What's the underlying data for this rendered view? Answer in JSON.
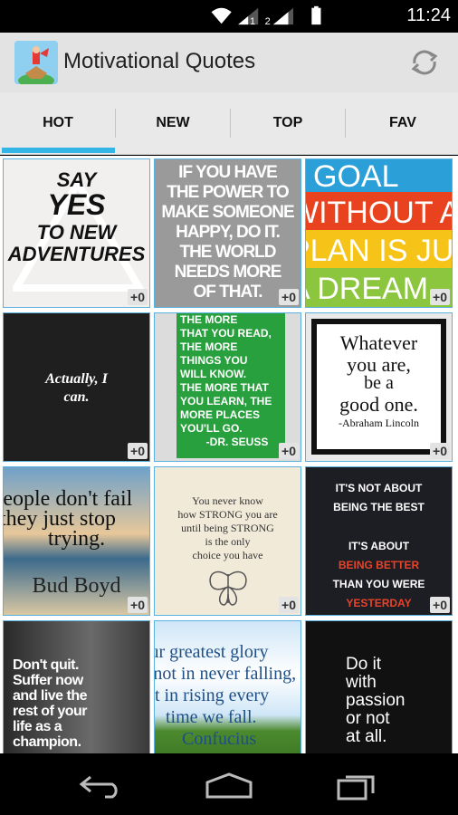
{
  "status_bar": {
    "time": "11:24",
    "sim1": "1",
    "sim2": "2"
  },
  "app": {
    "title": "Motivational Quotes"
  },
  "tabs": [
    {
      "label": "HOT",
      "active": true
    },
    {
      "label": "NEW",
      "active": false
    },
    {
      "label": "TOP",
      "active": false
    },
    {
      "label": "FAV",
      "active": false
    }
  ],
  "colors": {
    "accent": "#33b5e5",
    "action_bar": "#e3e3e3"
  },
  "tiles": [
    {
      "lines": [
        "SAY",
        "YES",
        "TO NEW",
        "ADVENTURES"
      ],
      "count": "+0"
    },
    {
      "lines": [
        "IF YOU HAVE",
        "THE POWER TO",
        "MAKE SOMEONE",
        "HAPPY, DO IT.",
        "THE WORLD",
        "NEEDS MORE",
        "OF THAT."
      ],
      "count": "+0"
    },
    {
      "lines": [
        "GOAL",
        "WITHOUT A",
        "PLAN IS JUST",
        "A DREAM."
      ],
      "count": "+0"
    },
    {
      "lines": [
        "Actually, I",
        "can."
      ],
      "count": "+0"
    },
    {
      "lines": [
        "THE MORE",
        "THAT YOU READ,",
        "THE MORE",
        "THINGS YOU",
        "WILL KNOW.",
        "THE MORE THAT",
        "YOU LEARN, THE",
        "MORE PLACES",
        "YOU'LL GO.",
        "-DR. SEUSS"
      ],
      "count": "+0"
    },
    {
      "lines": [
        "Whatever",
        "you are,",
        "be a",
        "good one.",
        "-Abraham Lincoln"
      ],
      "count": "+0"
    },
    {
      "lines": [
        "People don't fail",
        "they just stop",
        "trying.",
        "Bud Boyd"
      ],
      "count": "+0"
    },
    {
      "lines": [
        "You never know",
        "how STRONG you are",
        "until being STRONG",
        "is the only",
        "choice you have"
      ],
      "count": "+0"
    },
    {
      "lines": [
        "IT'S NOT ABOUT",
        "BEING THE BEST",
        "IT'S ABOUT",
        "BEING BETTER",
        "THAN YOU WERE",
        "YESTERDAY"
      ],
      "count": "+0"
    },
    {
      "lines": [
        "Don't quit.",
        "Suffer now",
        "and live the",
        "rest of your",
        "life as a",
        "champion."
      ]
    },
    {
      "lines": [
        "Our greatest glory",
        "is not in never falling,",
        "but in rising every",
        "time we fall.",
        "Confucius"
      ]
    },
    {
      "lines": [
        "Do it",
        "with",
        "passion",
        "or not",
        "at all."
      ]
    }
  ]
}
